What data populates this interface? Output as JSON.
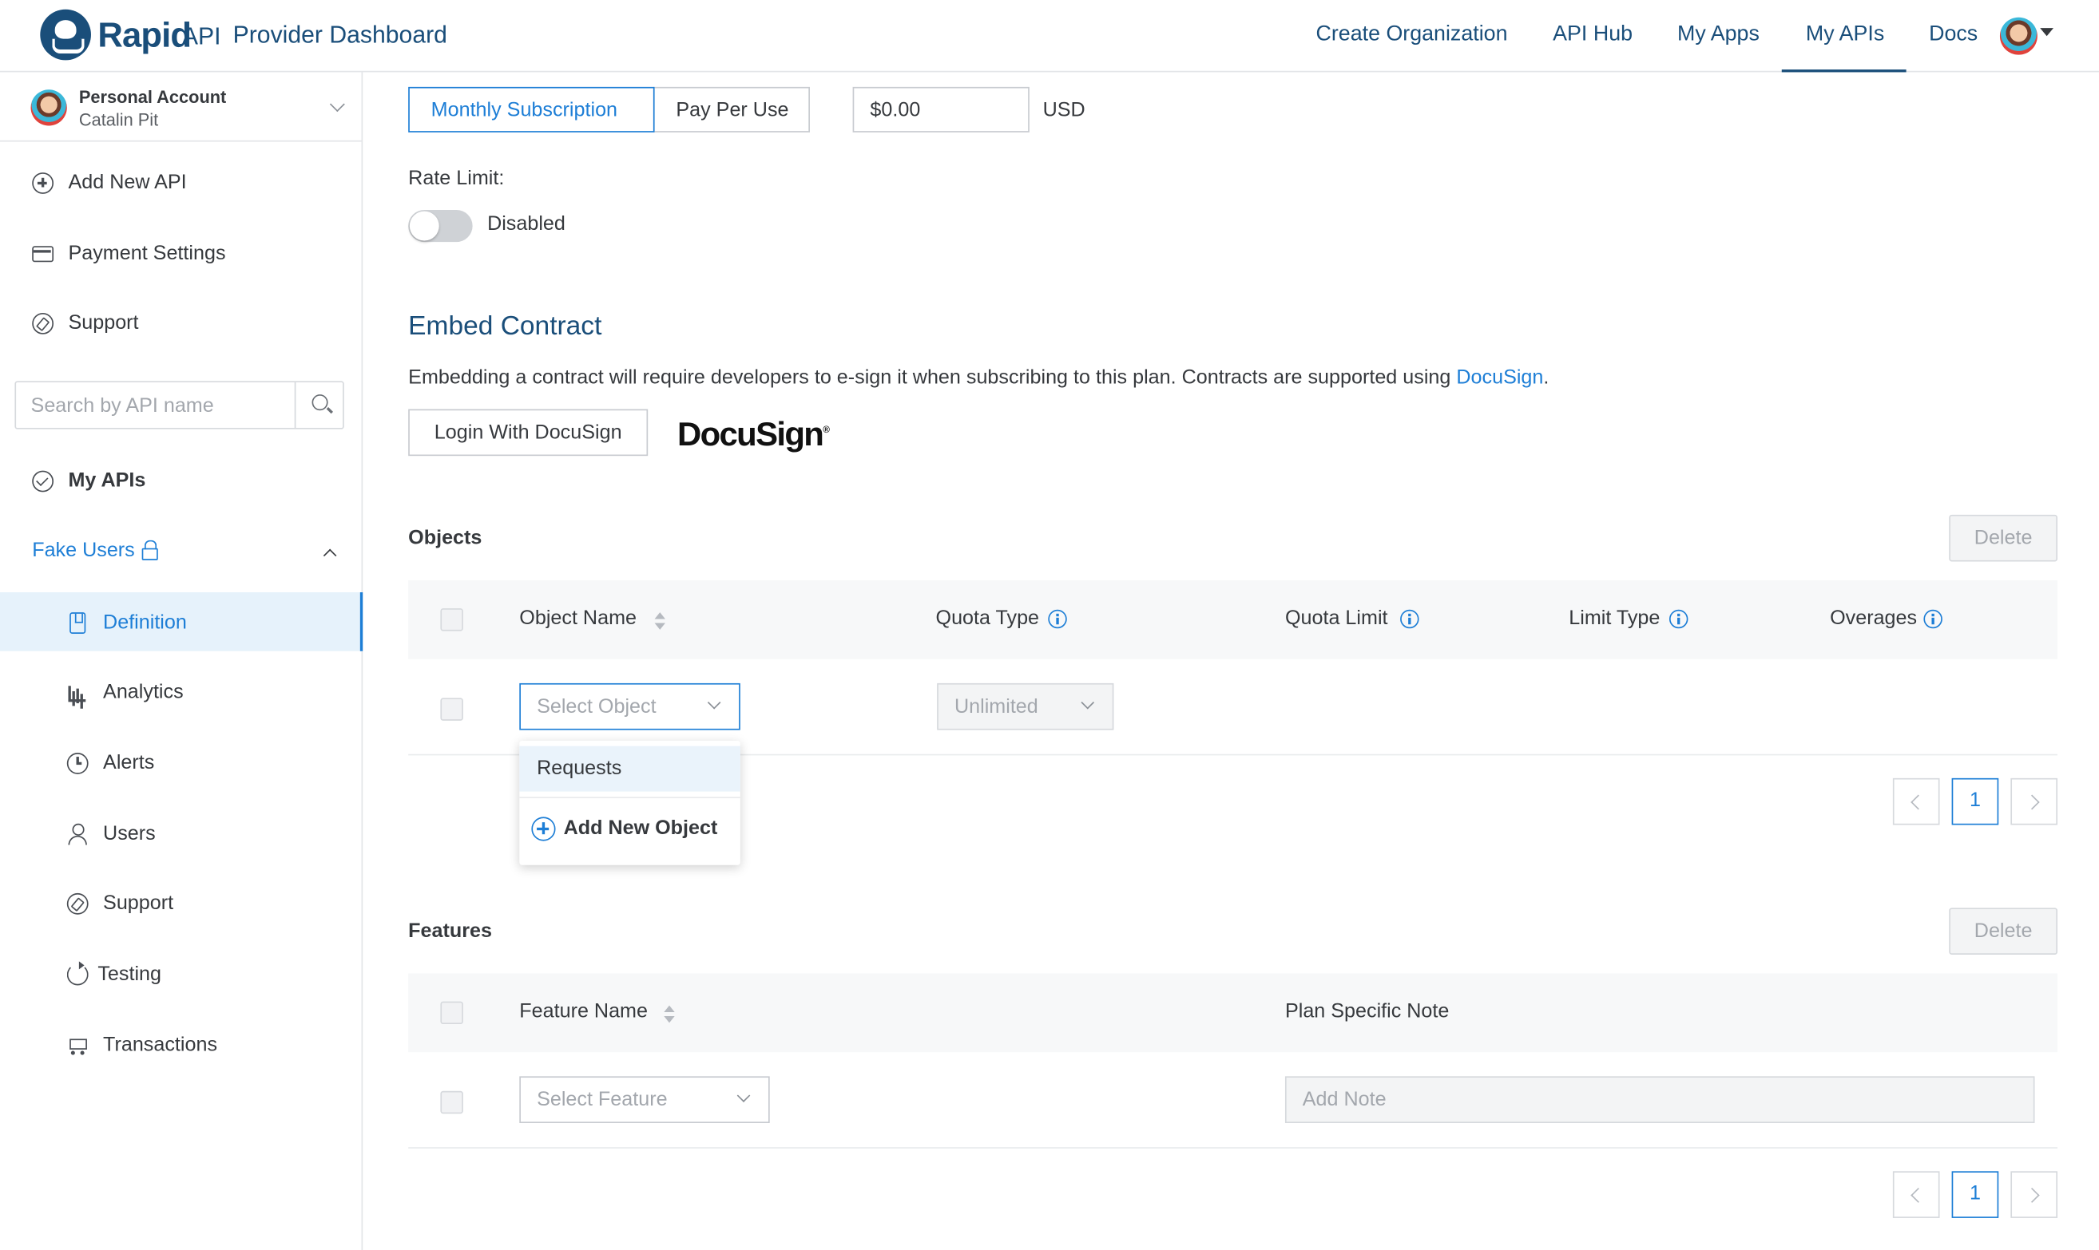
{
  "header": {
    "brand_name": "Rapid",
    "brand_suffix": "API",
    "brand_subtitle": "Provider Dashboard",
    "nav": [
      "Create Organization",
      "API Hub",
      "My Apps",
      "My APIs",
      "Docs"
    ],
    "active_nav": "My APIs"
  },
  "sidebar": {
    "account": {
      "title": "Personal Account",
      "name": "Catalin Pit"
    },
    "top_items": [
      {
        "label": "Add New API",
        "icon": "add-circle-icon"
      },
      {
        "label": "Payment Settings",
        "icon": "credit-card-icon"
      },
      {
        "label": "Support",
        "icon": "compass-icon"
      }
    ],
    "search_placeholder": "Search by API name",
    "my_apis_label": "My APIs",
    "api_name": "Fake Users",
    "api_items": [
      {
        "label": "Definition",
        "icon": "document-icon",
        "active": true
      },
      {
        "label": "Analytics",
        "icon": "bar-chart-icon"
      },
      {
        "label": "Alerts",
        "icon": "clock-icon"
      },
      {
        "label": "Users",
        "icon": "user-icon"
      },
      {
        "label": "Support",
        "icon": "compass-icon"
      },
      {
        "label": "Testing",
        "icon": "refresh-icon"
      },
      {
        "label": "Transactions",
        "icon": "cart-icon"
      }
    ]
  },
  "plan": {
    "billing_options": [
      "Monthly Subscription",
      "Pay Per Use"
    ],
    "selected_billing": "Monthly Subscription",
    "price_value": "$0.00",
    "currency": "USD",
    "rate_limit_label": "Rate Limit:",
    "rate_limit_status": "Disabled"
  },
  "contract": {
    "title": "Embed Contract",
    "description": "Embedding a contract will require developers to e-sign it when subscribing to this plan. Contracts are supported using ",
    "link_text": "DocuSign",
    "description_end": ".",
    "login_button": "Login With DocuSign",
    "logo_text": "DocuSign"
  },
  "objects": {
    "title": "Objects",
    "delete_label": "Delete",
    "columns": [
      "Object Name",
      "Quota Type",
      "Quota Limit",
      "Limit Type",
      "Overages"
    ],
    "row": {
      "object_placeholder": "Select Object",
      "quota_type": "Unlimited"
    },
    "dropdown": {
      "option": "Requests",
      "add_label": "Add New Object"
    },
    "page": "1"
  },
  "features": {
    "title": "Features",
    "delete_label": "Delete",
    "columns": [
      "Feature Name",
      "Plan Specific Note"
    ],
    "row": {
      "feature_placeholder": "Select Feature",
      "note_placeholder": "Add Note"
    },
    "page": "1"
  },
  "colors": {
    "brand": "#1a4e7a",
    "accent": "#1d7ed6",
    "active_bg": "#e6f2fb"
  }
}
